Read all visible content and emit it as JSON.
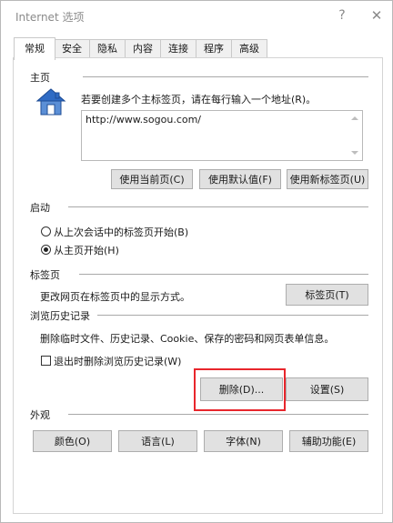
{
  "window": {
    "title": "Internet 选项",
    "help": "?",
    "close": "✕"
  },
  "tabs": [
    {
      "label": "常规",
      "active": true
    },
    {
      "label": "安全"
    },
    {
      "label": "隐私"
    },
    {
      "label": "内容"
    },
    {
      "label": "连接"
    },
    {
      "label": "程序"
    },
    {
      "label": "高级"
    }
  ],
  "home": {
    "heading": "主页",
    "instruction": "若要创建多个主标签页，请在每行输入一个地址(R)。",
    "url": "http://www.sogou.com/",
    "buttons": {
      "current": "使用当前页(C)",
      "default": "使用默认值(F)",
      "newtab": "使用新标签页(U)"
    }
  },
  "startup": {
    "heading": "启动",
    "options": [
      {
        "label": "从上次会话中的标签页开始(B)",
        "selected": false
      },
      {
        "label": "从主页开始(H)",
        "selected": true
      }
    ]
  },
  "tabs_section": {
    "heading": "标签页",
    "description": "更改网页在标签页中的显示方式。",
    "button": "标签页(T)"
  },
  "history": {
    "heading": "浏览历史记录",
    "description": "删除临时文件、历史记录、Cookie、保存的密码和网页表单信息。",
    "checkbox_label": "退出时删除浏览历史记录(W)",
    "checkbox_checked": false,
    "delete_button": "删除(D)...",
    "settings_button": "设置(S)"
  },
  "appearance": {
    "heading": "外观",
    "buttons": {
      "colors": "颜色(O)",
      "languages": "语言(L)",
      "fonts": "字体(N)",
      "accessibility": "辅助功能(E)"
    }
  },
  "colors": {
    "highlight": "#e8262c",
    "button_face": "#e1e1e1",
    "icon": "house-icon"
  }
}
